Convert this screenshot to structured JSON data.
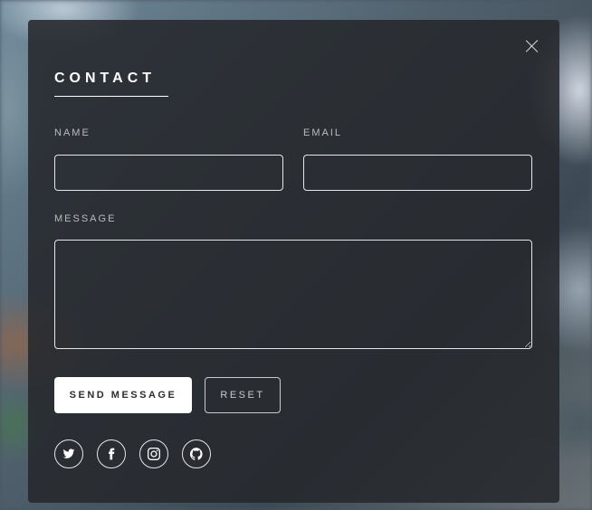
{
  "modal": {
    "title": "CONTACT",
    "close_icon": "close-icon"
  },
  "form": {
    "name_label": "NAME",
    "name_value": "",
    "email_label": "EMAIL",
    "email_value": "",
    "message_label": "MESSAGE",
    "message_value": ""
  },
  "buttons": {
    "send_label": "SEND MESSAGE",
    "reset_label": "RESET"
  },
  "social": [
    {
      "icon": "twitter-icon"
    },
    {
      "icon": "facebook-icon"
    },
    {
      "icon": "instagram-icon"
    },
    {
      "icon": "github-icon"
    }
  ],
  "colors": {
    "modal_background": "#26282c",
    "text": "#ffffff",
    "label": "#b8bcc0",
    "border": "#e4e6e8"
  }
}
